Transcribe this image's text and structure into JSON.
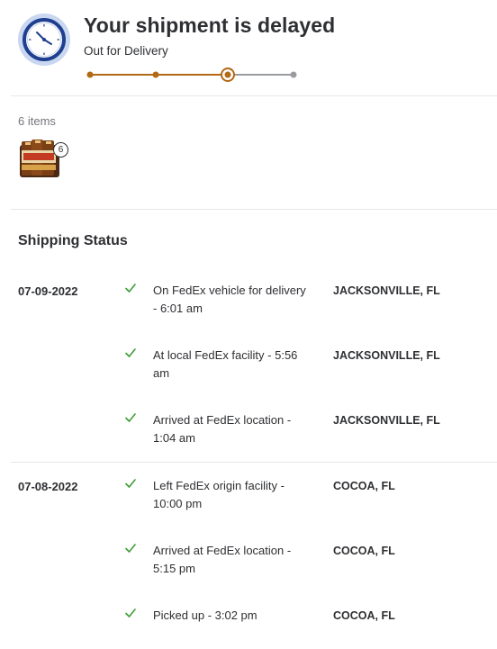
{
  "header": {
    "title": "Your shipment is delayed",
    "subtitle": "Out for Delivery",
    "progress": {
      "steps_total": 4,
      "current_step": 3
    },
    "icon": "clock-icon",
    "colors": {
      "progress_done": "#b36a16",
      "progress_pending": "#9a9b9e",
      "clock_ring": "#1f3f8f"
    }
  },
  "items": {
    "count_label": "6 items",
    "thumbnail_icon": "product-thumbnail",
    "quantity_badge": "6"
  },
  "shipping": {
    "title": "Shipping Status",
    "check_color": "#3f9c35",
    "groups": [
      {
        "date": "07-09-2022",
        "events": [
          {
            "desc": "On FedEx vehicle for delivery - 6:01 am",
            "location": "JACKSONVILLE, FL"
          },
          {
            "desc": "At local FedEx facility - 5:56 am",
            "location": "JACKSONVILLE, FL"
          },
          {
            "desc": "Arrived at FedEx location - 1:04 am",
            "location": "JACKSONVILLE, FL"
          }
        ]
      },
      {
        "date": "07-08-2022",
        "events": [
          {
            "desc": "Left FedEx origin facility - 10:00 pm",
            "location": "COCOA, FL"
          },
          {
            "desc": "Arrived at FedEx location - 5:15 pm",
            "location": "COCOA, FL"
          },
          {
            "desc": "Picked up - 3:02 pm",
            "location": "COCOA, FL"
          }
        ]
      }
    ]
  }
}
